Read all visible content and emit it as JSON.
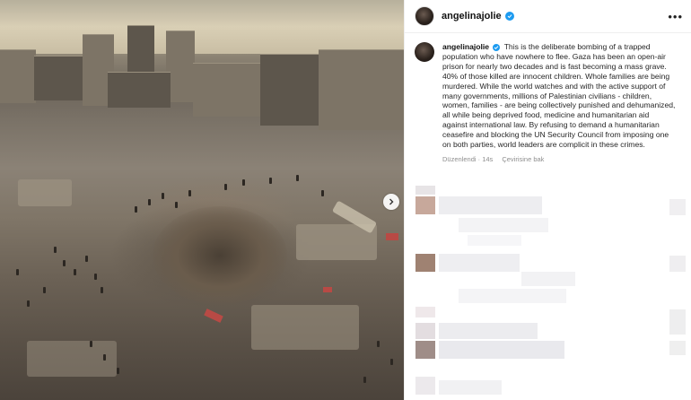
{
  "post": {
    "username": "angelinajolie",
    "caption_user": "angelinajolie",
    "caption": "This is the deliberate bombing of a trapped population who have nowhere to flee. Gaza has been an open-air prison for nearly two decades and is fast becoming a mass grave. 40% of those killed are innocent children. Whole families are being murdered. While the world watches and with the active support of many governments, millions of Palestinian civilians - children, women, families - are being collectively punished and dehumanized, all while being deprived food, medicine and humanitarian aid against international law. By refusing to demand a humanitarian ceasefire and blocking the UN Security Council from imposing one on both parties, world leaders are complicit in these crimes.",
    "meta": {
      "edited": "Düzenlendi",
      "separator": "·",
      "time": "14s",
      "translate": "Çevirisine bak"
    }
  },
  "icons": {
    "more": "more-options-icon",
    "verified": "verified-badge-icon",
    "next": "chevron-right-icon"
  },
  "colors": {
    "verified": "#1d9bf0",
    "meta_text": "#8e8e8e",
    "caption_text": "#262626"
  }
}
